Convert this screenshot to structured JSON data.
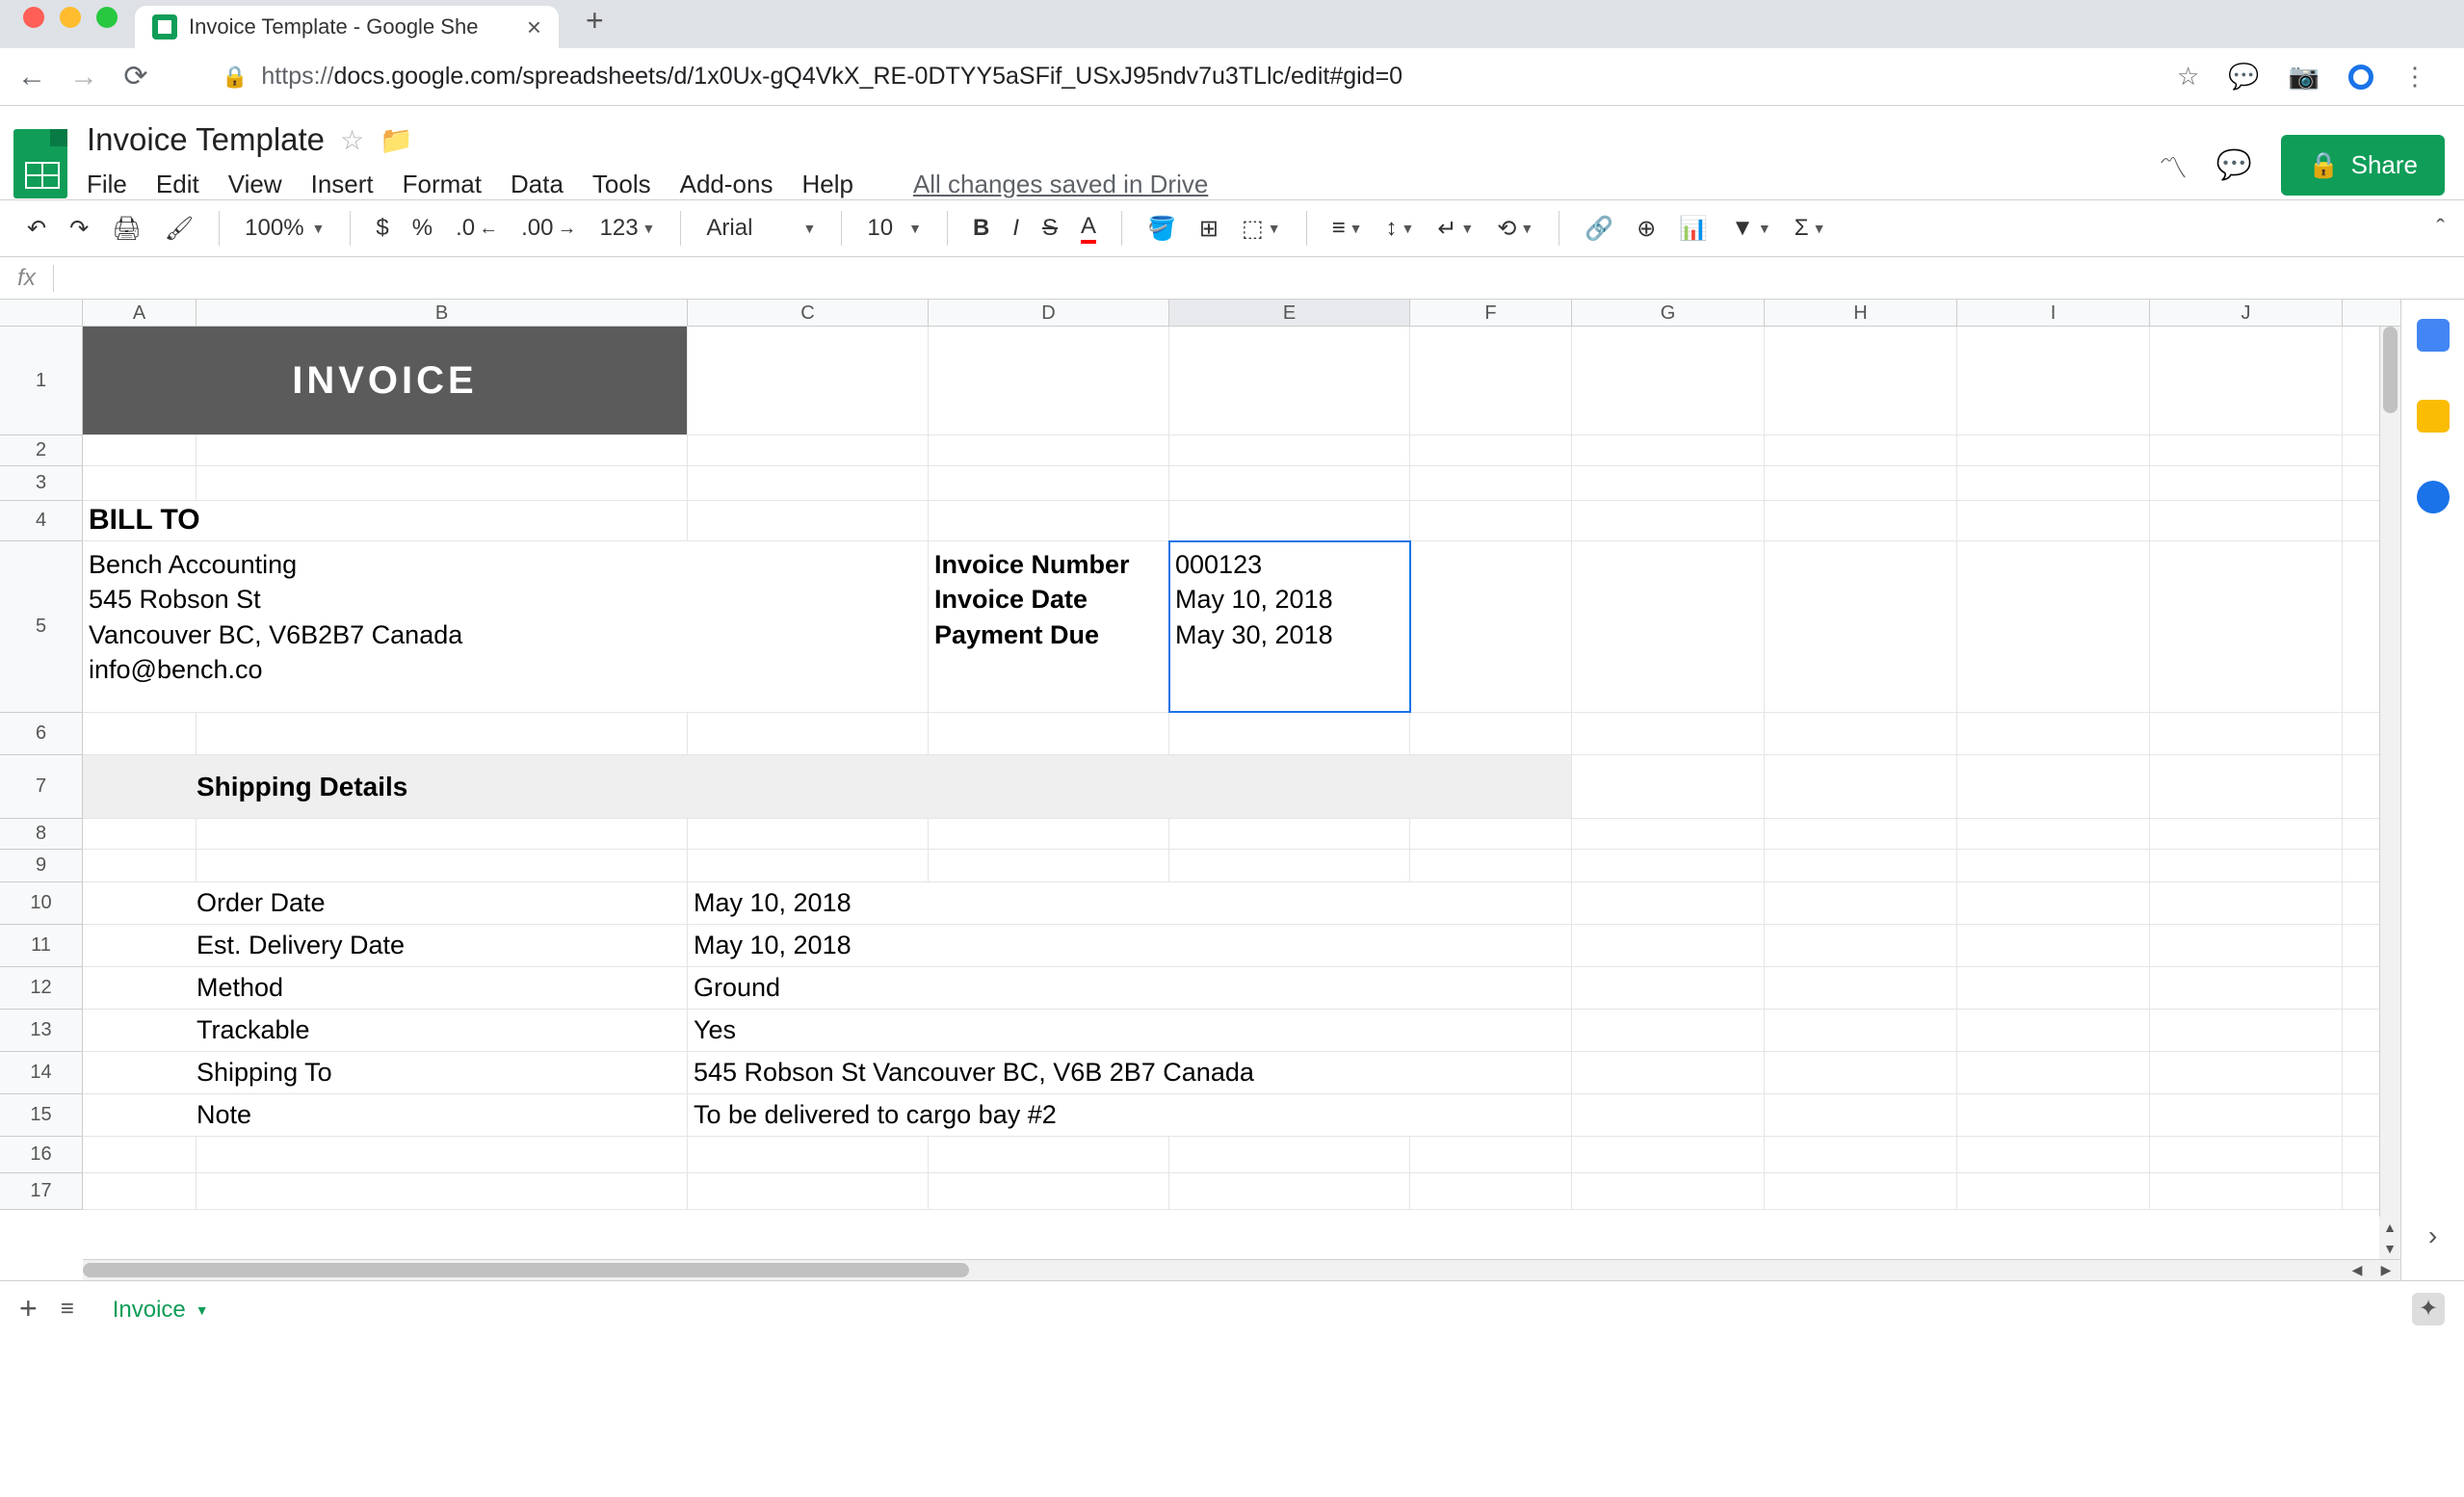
{
  "browser": {
    "tab_title": "Invoice Template - Google She",
    "url_proto": "https://",
    "url_rest": "docs.google.com/spreadsheets/d/1x0Ux-gQ4VkX_RE-0DTYY5aSFif_USxJ95ndv7u3TLlc/edit#gid=0"
  },
  "doc": {
    "title": "Invoice Template",
    "save_status": "All changes saved in Drive",
    "menus": [
      "File",
      "Edit",
      "View",
      "Insert",
      "Format",
      "Data",
      "Tools",
      "Add-ons",
      "Help"
    ],
    "share_label": "Share"
  },
  "toolbar": {
    "zoom": "100%",
    "font": "Arial",
    "size": "10",
    "num_fmt": "123"
  },
  "columns": [
    "A",
    "B",
    "C",
    "D",
    "E",
    "F",
    "G",
    "H",
    "I",
    "J"
  ],
  "rows": [
    "1",
    "2",
    "3",
    "4",
    "5",
    "6",
    "7",
    "8",
    "9",
    "10",
    "11",
    "12",
    "13",
    "14",
    "15",
    "16",
    "17"
  ],
  "sheet_tab": "Invoice",
  "content": {
    "banner": "INVOICE",
    "bill_to_label": "BILL TO",
    "bill_to_addr": "Bench Accounting\n545 Robson St\nVancouver BC, V6B2B7 Canada\ninfo@bench.co",
    "inv_num_lbl": "Invoice Number",
    "inv_num": "000123",
    "inv_date_lbl": "Invoice Date",
    "inv_date": "May 10, 2018",
    "pay_due_lbl": "Payment Due",
    "pay_due": "May 30, 2018",
    "ship_header": "Shipping Details",
    "ship": {
      "order_date_lbl": "Order Date",
      "order_date": "May 10, 2018",
      "est_lbl": "Est. Delivery Date",
      "est": "May 10, 2018",
      "method_lbl": "Method",
      "method": "Ground",
      "track_lbl": "Trackable",
      "track": "Yes",
      "to_lbl": "Shipping To",
      "to": "545 Robson St Vancouver BC, V6B 2B7 Canada",
      "note_lbl": "Note",
      "note": "To be delivered to cargo bay #2"
    }
  }
}
